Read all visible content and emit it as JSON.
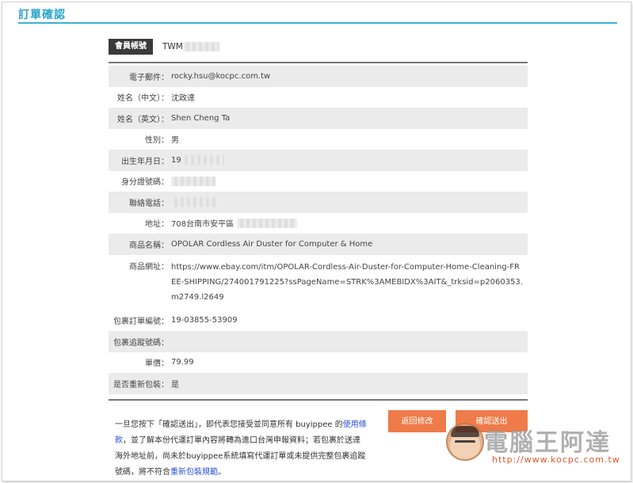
{
  "page": {
    "title": "訂單確認"
  },
  "account": {
    "badge": "會員帳號",
    "value_visible": "TWM"
  },
  "fields": {
    "email": {
      "label": "電子郵件：",
      "value": "rocky.hsu@kocpc.com.tw"
    },
    "name_zh": {
      "label": "姓名（中文）：",
      "value": "沈政達"
    },
    "name_en": {
      "label": "姓名（英文）：",
      "value": "Shen Cheng Ta"
    },
    "gender": {
      "label": "性別：",
      "value": "男"
    },
    "birthday": {
      "label": "出生年月日：",
      "value": "19"
    },
    "id_number": {
      "label": "身分證號碼：",
      "value": ""
    },
    "phone": {
      "label": "聯絡電話：",
      "value": ""
    },
    "address": {
      "label": "地址：",
      "value": "708台南市安平區"
    },
    "product_name": {
      "label": "商品名稱：",
      "value": "OPOLAR Cordless Air Duster for Computer & Home"
    },
    "product_url": {
      "label": "商品網址：",
      "value": "https://www.ebay.com/itm/OPOLAR-Cordless-Air-Duster-for-Computer-Home-Cleaning-FREE-SHIPPING/274001791225?ssPageName=STRK%3AMEBIDX%3AIT&_trksid=p2060353.m2749.l2649"
    },
    "order_no": {
      "label": "包裹訂單編號：",
      "value": "19-03855-53909"
    },
    "tracking_no": {
      "label": "包裹追蹤號碼：",
      "value": ""
    },
    "price": {
      "label": "單價：",
      "value": "79.99"
    },
    "repack": {
      "label": "是否重新包裝：",
      "value": "是"
    }
  },
  "notice": {
    "part1": "一旦您按下「確認送出」，即代表您接受並同意所有 buyippee 的",
    "link1": "使用條款",
    "part2": "，並了解本份代運訂單內容將轉為進口台灣申報資料；若包裹於送達海外地址前，尚未於buyippee系統填寫代運訂單或未提供完整包裹追蹤號碼，將不符合",
    "link2": "重新包裝規範",
    "part3": "。"
  },
  "buttons": {
    "back": "返回修改",
    "confirm": "確認送出"
  },
  "watermark": {
    "title": "電腦王阿達",
    "url": "http://www.kocpc.com.tw"
  },
  "colors": {
    "accent": "#3fb0d0",
    "button": "#ef7b4a",
    "link": "#2a4fd8"
  }
}
